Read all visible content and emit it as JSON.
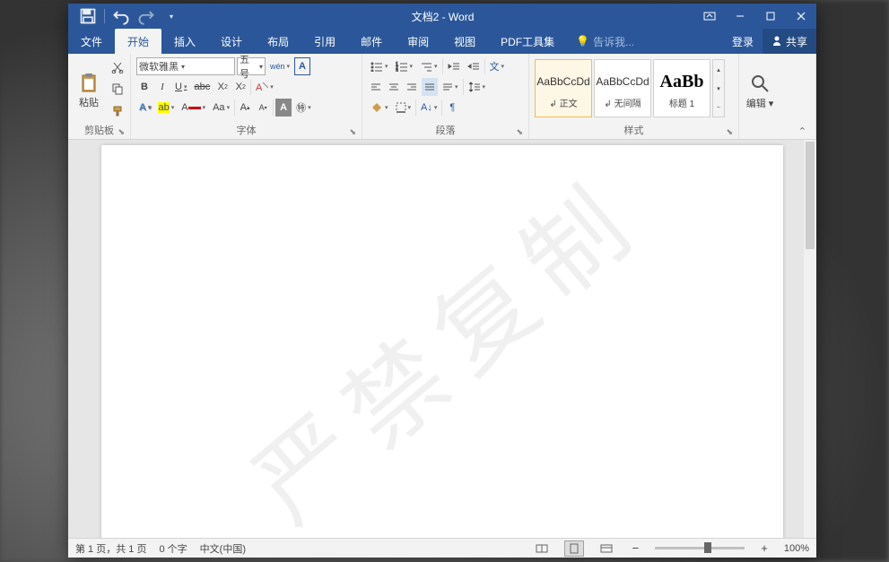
{
  "title": "文档2 - Word",
  "qat": {
    "save": "保存",
    "undo": "撤销",
    "redo": "重做"
  },
  "tabs": [
    "文件",
    "开始",
    "插入",
    "设计",
    "布局",
    "引用",
    "邮件",
    "审阅",
    "视图",
    "PDF工具集"
  ],
  "active_tab_index": 1,
  "tell_me": "告诉我...",
  "login": "登录",
  "share": "共享",
  "ribbon": {
    "clipboard": {
      "label": "剪贴板",
      "paste": "粘贴"
    },
    "font": {
      "label": "字体",
      "name": "微软雅黑",
      "size": "五号",
      "wen": "wén",
      "bold": "B",
      "italic": "I",
      "underline": "U",
      "grow": "A",
      "shrink": "A",
      "aa": "Aa"
    },
    "paragraph": {
      "label": "段落"
    },
    "styles": {
      "label": "样式",
      "items": [
        {
          "preview": "AaBbCcDd",
          "name": "正文",
          "selected": true
        },
        {
          "preview": "AaBbCcDd",
          "name": "无间隔",
          "selected": false
        },
        {
          "preview": "AaBb",
          "name": "标题 1",
          "selected": false
        }
      ]
    },
    "editing": {
      "label": "编辑"
    }
  },
  "watermark": "严禁复制",
  "status": {
    "page": "第 1 页，共 1 页",
    "words": "0 个字",
    "lang": "中文(中国)",
    "zoom": "100%"
  }
}
